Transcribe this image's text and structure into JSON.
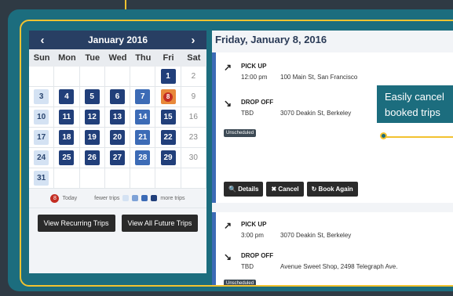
{
  "calendar": {
    "prev": "‹",
    "next": "›",
    "month_title": "January 2016",
    "weekdays": [
      "Sun",
      "Mon",
      "Tue",
      "Wed",
      "Thu",
      "Fri",
      "Sat"
    ],
    "weeks": [
      [
        {
          "d": "",
          "l": 0
        },
        {
          "d": "",
          "l": 0
        },
        {
          "d": "",
          "l": 0
        },
        {
          "d": "",
          "l": 0
        },
        {
          "d": "",
          "l": 0
        },
        {
          "d": "1",
          "l": 4
        },
        {
          "d": "2",
          "l": 0
        }
      ],
      [
        {
          "d": "3",
          "l": 1
        },
        {
          "d": "4",
          "l": 4
        },
        {
          "d": "5",
          "l": 4
        },
        {
          "d": "6",
          "l": 4
        },
        {
          "d": "7",
          "l": 3
        },
        {
          "d": "8",
          "l": 5
        },
        {
          "d": "9",
          "l": 0
        }
      ],
      [
        {
          "d": "10",
          "l": 1
        },
        {
          "d": "11",
          "l": 4
        },
        {
          "d": "12",
          "l": 4
        },
        {
          "d": "13",
          "l": 4
        },
        {
          "d": "14",
          "l": 3
        },
        {
          "d": "15",
          "l": 4
        },
        {
          "d": "16",
          "l": 0
        }
      ],
      [
        {
          "d": "17",
          "l": 1
        },
        {
          "d": "18",
          "l": 4
        },
        {
          "d": "19",
          "l": 4
        },
        {
          "d": "20",
          "l": 4
        },
        {
          "d": "21",
          "l": 3
        },
        {
          "d": "22",
          "l": 4
        },
        {
          "d": "23",
          "l": 0
        }
      ],
      [
        {
          "d": "24",
          "l": 1
        },
        {
          "d": "25",
          "l": 4
        },
        {
          "d": "26",
          "l": 4
        },
        {
          "d": "27",
          "l": 4
        },
        {
          "d": "28",
          "l": 3
        },
        {
          "d": "29",
          "l": 4
        },
        {
          "d": "30",
          "l": 0
        }
      ],
      [
        {
          "d": "31",
          "l": 1
        },
        {
          "d": "",
          "l": 0
        },
        {
          "d": "",
          "l": 0
        },
        {
          "d": "",
          "l": 0
        },
        {
          "d": "",
          "l": 0
        },
        {
          "d": "",
          "l": 0
        },
        {
          "d": "",
          "l": 0
        }
      ]
    ],
    "legend": {
      "today_marker": "8",
      "today_label": "Today",
      "fewer_label": "fewer trips",
      "more_label": "more trips",
      "scale_colors": [
        "#d4e2f3",
        "#7ea2d7",
        "#3c6bb6",
        "#213f7a"
      ]
    },
    "btn_recurring": "View Recurring Trips",
    "btn_future": "View All Future Trips"
  },
  "details": {
    "date_title": "Friday, January 8, 2016",
    "trips": [
      {
        "pickup_label": "PICK UP",
        "pickup_time": "12:00 pm",
        "pickup_addr": "100 Main St, San Francisco",
        "dropoff_label": "DROP OFF",
        "dropoff_time": "TBD",
        "dropoff_addr": "3070 Deakin St, Berkeley",
        "status": "Unscheduled",
        "btn_details": "Details",
        "btn_cancel": "Cancel",
        "btn_book_again": "Book Again"
      },
      {
        "pickup_label": "PICK UP",
        "pickup_time": "3:00 pm",
        "pickup_addr": "3070 Deakin St, Berkeley",
        "dropoff_label": "DROP OFF",
        "dropoff_time": "TBD",
        "dropoff_addr": "Avenue Sweet Shop, 2498 Telegraph Ave.",
        "status": "Unscheduled"
      }
    ]
  },
  "callout": {
    "line1": "Easily cancel",
    "line2": "booked trips"
  },
  "icons": {
    "pickup": "↗",
    "dropoff": "↘",
    "details": "🔍",
    "cancel": "✖",
    "book_again": "↻"
  }
}
